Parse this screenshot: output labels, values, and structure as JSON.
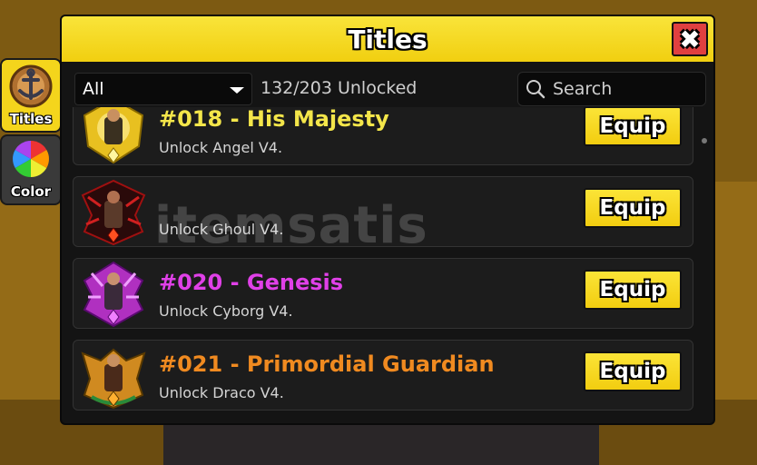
{
  "window": {
    "title": "Titles",
    "close_icon": "close-icon"
  },
  "side_tabs": [
    {
      "label": "Titles",
      "icon": "anchor-emblem-icon",
      "active": true
    },
    {
      "label": "Color",
      "icon": "color-wheel-icon",
      "active": false
    }
  ],
  "toolbar": {
    "filter_value": "All",
    "unlock_count": "132/203 Unlocked",
    "search_placeholder": "Search"
  },
  "titles": [
    {
      "name": "#018 - His Majesty",
      "desc": "Unlock Angel V4.",
      "color": "#f4e64a",
      "emblem": "gold-angel-emblem-icon",
      "button": "Equip"
    },
    {
      "name": "",
      "desc": "Unlock Ghoul V4.",
      "color": "#e03030",
      "emblem": "red-ghoul-emblem-icon",
      "button": "Equip"
    },
    {
      "name": "#020 - Genesis",
      "desc": "Unlock Cyborg V4.",
      "color": "#e040e8",
      "emblem": "purple-cyborg-emblem-icon",
      "button": "Equip"
    },
    {
      "name": "#021 - Primordial Guardian",
      "desc": "Unlock Draco V4.",
      "color": "#f08a20",
      "emblem": "orange-draco-emblem-icon",
      "button": "Equip"
    }
  ],
  "watermark": "itemsatis"
}
